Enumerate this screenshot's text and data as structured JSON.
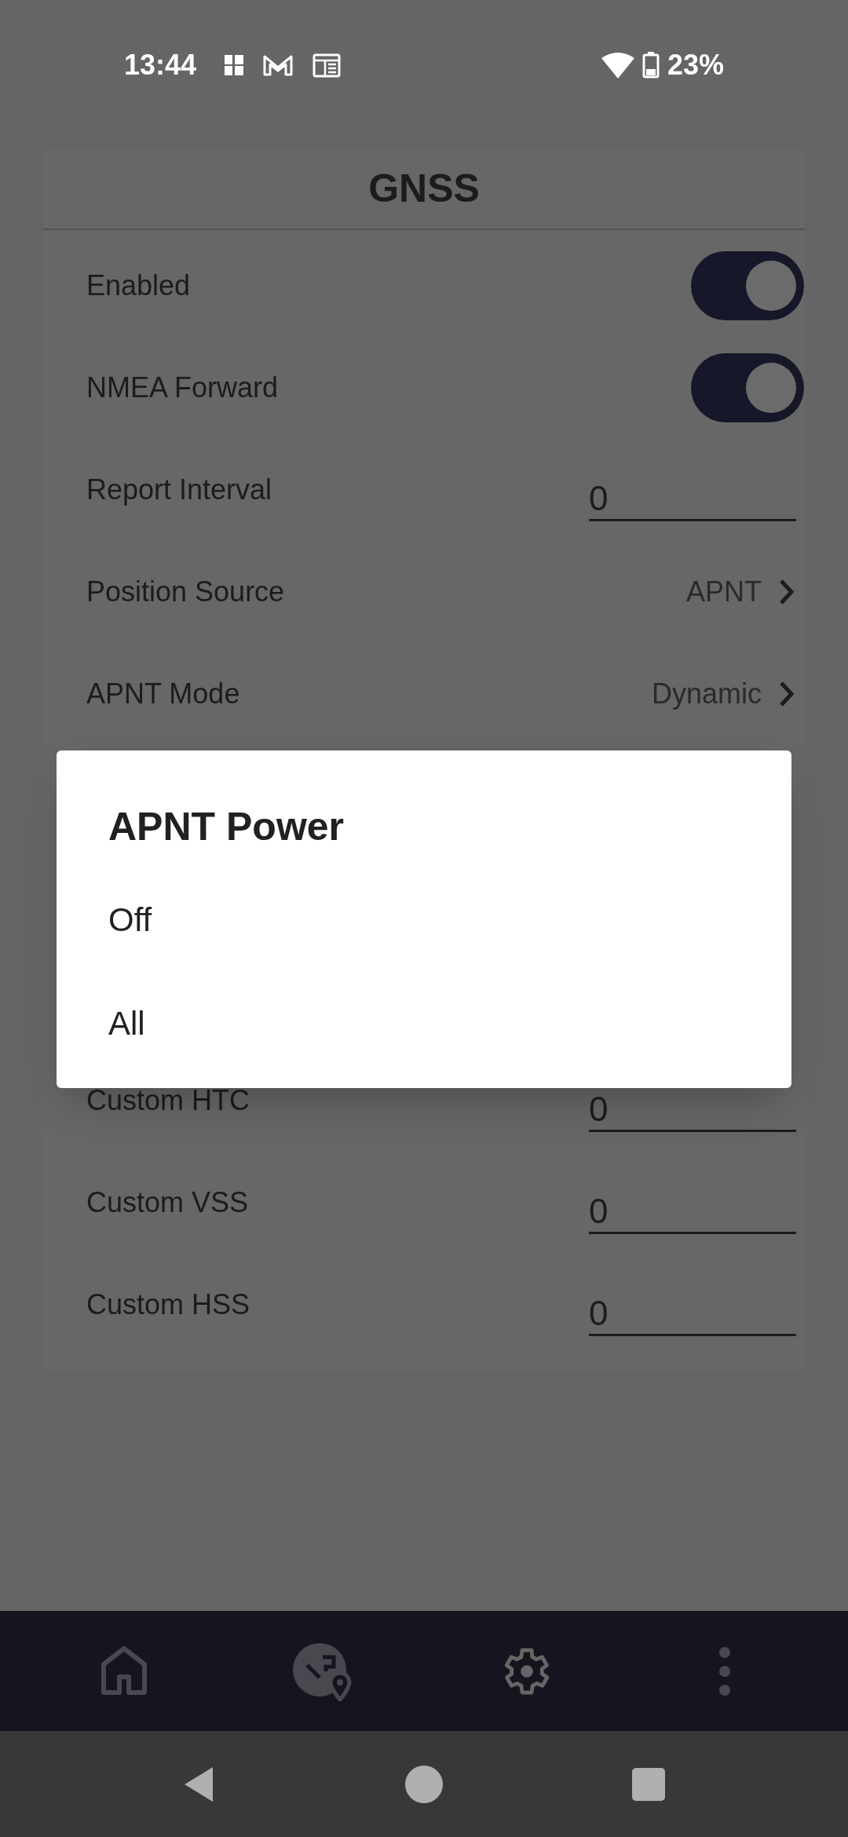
{
  "status_bar": {
    "time": "13:44",
    "battery": "23%"
  },
  "card": {
    "title": "GNSS",
    "rows_top": [
      {
        "label": "Enabled",
        "kind": "toggle",
        "on": true
      },
      {
        "label": "NMEA Forward",
        "kind": "toggle",
        "on": true
      },
      {
        "label": "Report Interval",
        "kind": "number",
        "value": "0"
      },
      {
        "label": "Position Source",
        "kind": "select",
        "value": "APNT"
      },
      {
        "label": "APNT Mode",
        "kind": "select",
        "value": "Dynamic"
      }
    ],
    "rows_bottom": [
      {
        "label": "Custom HTC",
        "kind": "number",
        "value": "0"
      },
      {
        "label": "Custom VSS",
        "kind": "number",
        "value": "0"
      },
      {
        "label": "Custom HSS",
        "kind": "number",
        "value": "0"
      }
    ]
  },
  "dialog": {
    "title": "APNT Power",
    "options": [
      "Off",
      "All"
    ]
  },
  "bottom_nav": [
    {
      "kind": "home",
      "selected": false
    },
    {
      "kind": "globe",
      "selected": false
    },
    {
      "kind": "settings",
      "selected": true
    },
    {
      "kind": "more",
      "selected": false
    }
  ]
}
